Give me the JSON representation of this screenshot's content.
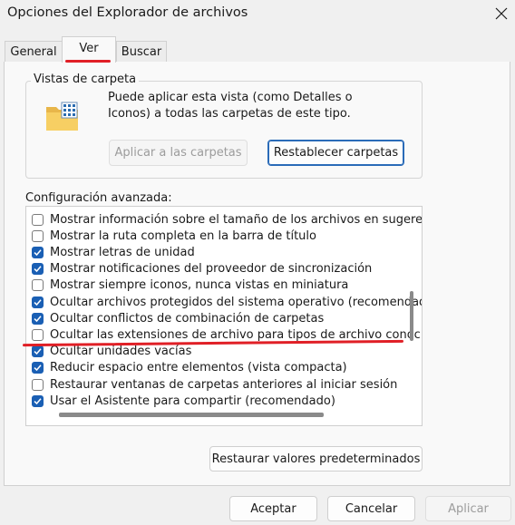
{
  "window": {
    "title": "Opciones del Explorador de archivos"
  },
  "tabs": [
    {
      "label": "General"
    },
    {
      "label": "Ver"
    },
    {
      "label": "Buscar"
    }
  ],
  "folder_views": {
    "legend": "Vistas de carpeta",
    "description": "Puede aplicar esta vista (como Detalles o Iconos) a todas las carpetas de este tipo.",
    "apply_label": "Aplicar a las carpetas",
    "reset_label": "Restablecer carpetas"
  },
  "advanced": {
    "label": "Configuración avanzada:",
    "items": [
      {
        "label": "Mostrar información sobre el tamaño de los archivos en sugerencias de carpeta",
        "checked": false
      },
      {
        "label": "Mostrar la ruta completa en la barra de título",
        "checked": false
      },
      {
        "label": "Mostrar letras de unidad",
        "checked": true
      },
      {
        "label": "Mostrar notificaciones del proveedor de sincronización",
        "checked": true
      },
      {
        "label": "Mostrar siempre iconos, nunca vistas en miniatura",
        "checked": false
      },
      {
        "label": "Ocultar archivos protegidos del sistema operativo (recomendado)",
        "checked": true
      },
      {
        "label": "Ocultar conflictos de combinación de carpetas",
        "checked": true
      },
      {
        "label": "Ocultar las extensiones de archivo para tipos de archivo conocidos",
        "checked": false
      },
      {
        "label": "Ocultar unidades vacías",
        "checked": true
      },
      {
        "label": "Reducir espacio entre elementos (vista compacta)",
        "checked": true
      },
      {
        "label": "Restaurar ventanas de carpetas anteriores al iniciar sesión",
        "checked": false
      },
      {
        "label": "Usar el Asistente para compartir (recomendado)",
        "checked": true
      }
    ],
    "restore_defaults_label": "Restaurar valores predeterminados"
  },
  "footer": {
    "ok_label": "Aceptar",
    "cancel_label": "Cancelar",
    "apply_label": "Aplicar"
  },
  "colors": {
    "accent": "#1a5fb4",
    "highlight_red": "#e01f26"
  }
}
